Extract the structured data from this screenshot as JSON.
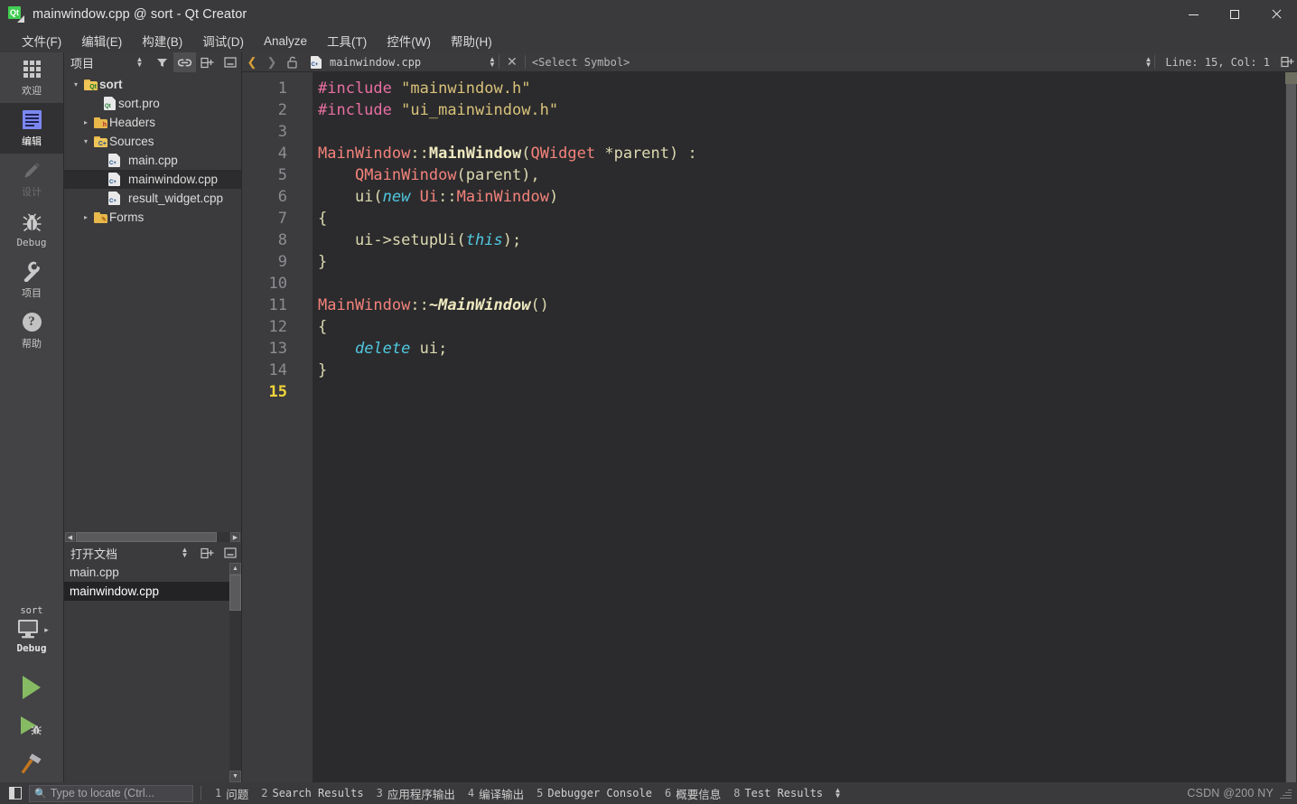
{
  "window": {
    "title": "mainwindow.cpp @ sort - Qt Creator",
    "app_icon": "qt-logo-icon",
    "controls": {
      "minimize": "minimize-icon",
      "maximize": "maximize-icon",
      "close": "close-icon"
    }
  },
  "menubar": {
    "items": [
      {
        "label": "文件(F)"
      },
      {
        "label": "编辑(E)"
      },
      {
        "label": "构建(B)"
      },
      {
        "label": "调试(D)"
      },
      {
        "label": "Analyze"
      },
      {
        "label": "工具(T)"
      },
      {
        "label": "控件(W)"
      },
      {
        "label": "帮助(H)"
      }
    ]
  },
  "modebar": {
    "modes": [
      {
        "label": "欢迎",
        "icon": "grid-icon",
        "state": "normal"
      },
      {
        "label": "编辑",
        "icon": "document-edit-icon",
        "state": "active"
      },
      {
        "label": "设计",
        "icon": "pencil-icon",
        "state": "disabled"
      },
      {
        "label": "Debug",
        "icon": "bug-icon",
        "state": "normal"
      },
      {
        "label": "项目",
        "icon": "wrench-icon",
        "state": "normal"
      },
      {
        "label": "帮助",
        "icon": "question-circle-icon",
        "state": "normal"
      }
    ],
    "kit": {
      "project": "sort",
      "icon": "monitor-icon",
      "config": "Debug",
      "arrow": "▸"
    },
    "actions": [
      {
        "name": "run",
        "icon": "play-icon"
      },
      {
        "name": "debug",
        "icon": "play-bug-icon"
      },
      {
        "name": "build",
        "icon": "hammer-icon"
      }
    ]
  },
  "project_dock": {
    "title": "项目",
    "toolbar": [
      {
        "icon": "sort-updown-icon"
      },
      {
        "icon": "filter-icon"
      },
      {
        "icon": "link-icon",
        "active": true
      },
      {
        "icon": "split-add-icon"
      },
      {
        "icon": "collapse-icon"
      }
    ],
    "tree": [
      {
        "depth": 0,
        "twist": "▾",
        "icon": "folder-qt",
        "label": "sort",
        "bold": true,
        "selected": false
      },
      {
        "depth": 1,
        "twist": "",
        "icon": "file-qt",
        "label": "sort.pro",
        "bold": false,
        "selected": false
      },
      {
        "depth": 1,
        "twist": "▸",
        "icon": "folder-h",
        "label": "Headers",
        "bold": false,
        "selected": false
      },
      {
        "depth": 1,
        "twist": "▾",
        "icon": "folder-cpp",
        "label": "Sources",
        "bold": false,
        "selected": false
      },
      {
        "depth": 2,
        "twist": "",
        "icon": "file-cpp",
        "label": "main.cpp",
        "bold": false,
        "selected": false
      },
      {
        "depth": 2,
        "twist": "",
        "icon": "file-cpp",
        "label": "mainwindow.cpp",
        "bold": false,
        "selected": true
      },
      {
        "depth": 2,
        "twist": "",
        "icon": "file-cpp",
        "label": "result_widget.cpp",
        "bold": false,
        "selected": false
      },
      {
        "depth": 1,
        "twist": "▸",
        "icon": "folder-ui",
        "label": "Forms",
        "bold": false,
        "selected": false
      }
    ]
  },
  "open_documents": {
    "title": "打开文档",
    "toolbar": [
      {
        "icon": "sort-updown-icon"
      },
      {
        "icon": "split-add-icon"
      },
      {
        "icon": "collapse-icon"
      }
    ],
    "items": [
      {
        "label": "main.cpp",
        "selected": false
      },
      {
        "label": "mainwindow.cpp",
        "selected": true
      }
    ]
  },
  "editor_toolbar": {
    "nav_back": "chevron-left-icon",
    "nav_forward": "chevron-right-icon",
    "lock": "unlock-icon",
    "file_icon": "file-cpp-icon",
    "filename": "mainwindow.cpp",
    "file_dropdown": "sort-updown-icon",
    "close": "close-icon",
    "symbol_selector": "<Select Symbol>",
    "symbol_dropdown": "sort-updown-icon",
    "line_col": "Line: 15, Col: 1",
    "split": "split-add-icon"
  },
  "editor": {
    "current_line": 15,
    "fold_lines": [
      6,
      11
    ],
    "lines": [
      {
        "n": 1,
        "tokens": [
          {
            "t": "#include",
            "c": "pre"
          },
          {
            "t": " ",
            "c": "plain"
          },
          {
            "t": "\"mainwindow.h\"",
            "c": "str"
          }
        ]
      },
      {
        "n": 2,
        "tokens": [
          {
            "t": "#include",
            "c": "pre"
          },
          {
            "t": " ",
            "c": "plain"
          },
          {
            "t": "\"ui_mainwindow.h\"",
            "c": "str"
          }
        ]
      },
      {
        "n": 3,
        "tokens": []
      },
      {
        "n": 4,
        "tokens": [
          {
            "t": "MainWindow",
            "c": "type"
          },
          {
            "t": "::",
            "c": "plain"
          },
          {
            "t": "MainWindow",
            "c": "fn"
          },
          {
            "t": "(",
            "c": "plain"
          },
          {
            "t": "QWidget",
            "c": "type"
          },
          {
            "t": " *parent) :",
            "c": "plain"
          }
        ]
      },
      {
        "n": 5,
        "tokens": [
          {
            "t": "    ",
            "c": "plain"
          },
          {
            "t": "QMainWindow",
            "c": "type"
          },
          {
            "t": "(parent),",
            "c": "plain"
          }
        ]
      },
      {
        "n": 6,
        "tokens": [
          {
            "t": "    ui(",
            "c": "plain"
          },
          {
            "t": "new",
            "c": "kw"
          },
          {
            "t": " ",
            "c": "plain"
          },
          {
            "t": "Ui",
            "c": "type"
          },
          {
            "t": "::",
            "c": "plain"
          },
          {
            "t": "MainWindow",
            "c": "type"
          },
          {
            "t": ")",
            "c": "plain"
          }
        ]
      },
      {
        "n": 7,
        "tokens": [
          {
            "t": "{",
            "c": "plain"
          }
        ]
      },
      {
        "n": 8,
        "tokens": [
          {
            "t": "    ui->setupUi(",
            "c": "plain"
          },
          {
            "t": "this",
            "c": "kw"
          },
          {
            "t": ");",
            "c": "plain"
          }
        ]
      },
      {
        "n": 9,
        "tokens": [
          {
            "t": "}",
            "c": "plain"
          }
        ]
      },
      {
        "n": 10,
        "tokens": []
      },
      {
        "n": 11,
        "tokens": [
          {
            "t": "MainWindow",
            "c": "type"
          },
          {
            "t": "::",
            "c": "plain"
          },
          {
            "t": "~MainWindow",
            "c": "fni"
          },
          {
            "t": "()",
            "c": "plain"
          }
        ]
      },
      {
        "n": 12,
        "tokens": [
          {
            "t": "{",
            "c": "plain"
          }
        ]
      },
      {
        "n": 13,
        "tokens": [
          {
            "t": "    ",
            "c": "plain"
          },
          {
            "t": "delete",
            "c": "kw"
          },
          {
            "t": " ui;",
            "c": "plain"
          }
        ]
      },
      {
        "n": 14,
        "tokens": [
          {
            "t": "}",
            "c": "plain"
          }
        ]
      },
      {
        "n": 15,
        "tokens": []
      }
    ]
  },
  "statusbar": {
    "sidebar_toggle": "panel-toggle-icon",
    "locator_placeholder": "Type to locate (Ctrl...",
    "locator_value": "",
    "locator_icon": "search-icon",
    "outputs": [
      {
        "num": "1",
        "label": "问题",
        "cn": true
      },
      {
        "num": "2",
        "label": "Search Results",
        "cn": false
      },
      {
        "num": "3",
        "label": "应用程序输出",
        "cn": true
      },
      {
        "num": "4",
        "label": "编译输出",
        "cn": true
      },
      {
        "num": "5",
        "label": "Debugger Console",
        "cn": false
      },
      {
        "num": "6",
        "label": "概要信息",
        "cn": true
      },
      {
        "num": "8",
        "label": "Test Results",
        "cn": false
      }
    ],
    "more_icon": "sort-updown-icon",
    "watermark": "CSDN @200  NY"
  },
  "colors": {
    "titlebar_bg": "#3a3a3c",
    "editor_bg": "#2b2b2d",
    "gutter_bg": "#3c3c3e",
    "accent_yellow": "#f1d53a",
    "qt_green": "#41cd52",
    "run_green": "#86bb63",
    "selection_bg": "#232325"
  }
}
